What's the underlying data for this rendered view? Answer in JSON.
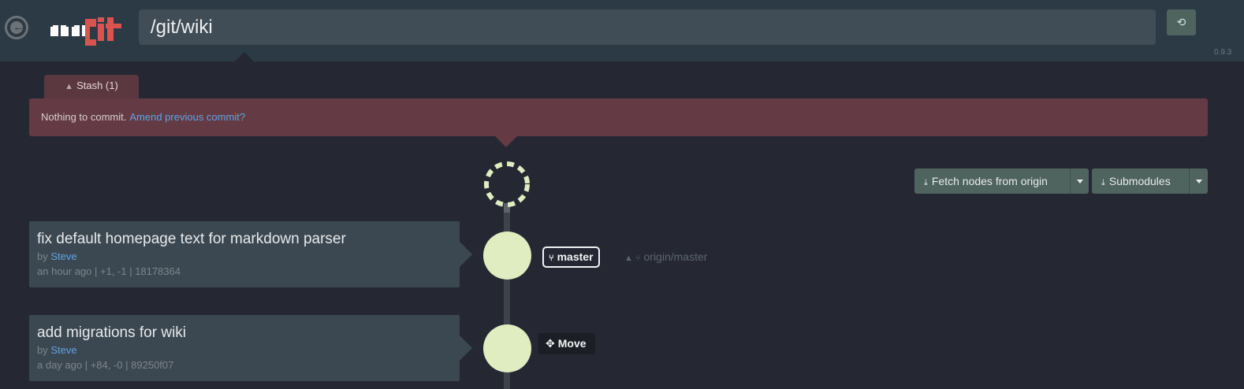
{
  "header": {
    "repo_path": "/git/wiki",
    "version": "0.9.3",
    "logo_text": "ungit",
    "colors": {
      "bar": "#2c3a45",
      "logo_white": "#ffffff",
      "logo_red": "#d9534f"
    }
  },
  "stash": {
    "label": "Stash (1)"
  },
  "status": {
    "message": "Nothing to commit.",
    "amend_link": "Amend previous commit?"
  },
  "actions": {
    "fetch_label": "Fetch nodes from origin",
    "submodules_label": "Submodules"
  },
  "commits": [
    {
      "title": "fix default homepage text for markdown parser",
      "by": "by",
      "author": "Steve",
      "meta": "an hour ago | +1, -1 | 18178364"
    },
    {
      "title": "add migrations for wiki",
      "by": "by",
      "author": "Steve",
      "meta": "a day ago | +84, -0 | 89250f07"
    }
  ],
  "refs": {
    "local_branch": "master",
    "remote_branch": "origin/master",
    "move_label": "Move"
  },
  "icons": {
    "back": "arrow-left-circle-icon",
    "refresh": "refresh-icon",
    "chevron_up": "chevron-up-icon",
    "download": "download-icon",
    "branch": "branch-icon",
    "warning": "warning-icon",
    "move": "move-icon"
  },
  "colors": {
    "background": "#252833",
    "alert": "#643a44",
    "node": "#dfedc0",
    "button": "#4f635f",
    "link": "#5fa3e3"
  }
}
